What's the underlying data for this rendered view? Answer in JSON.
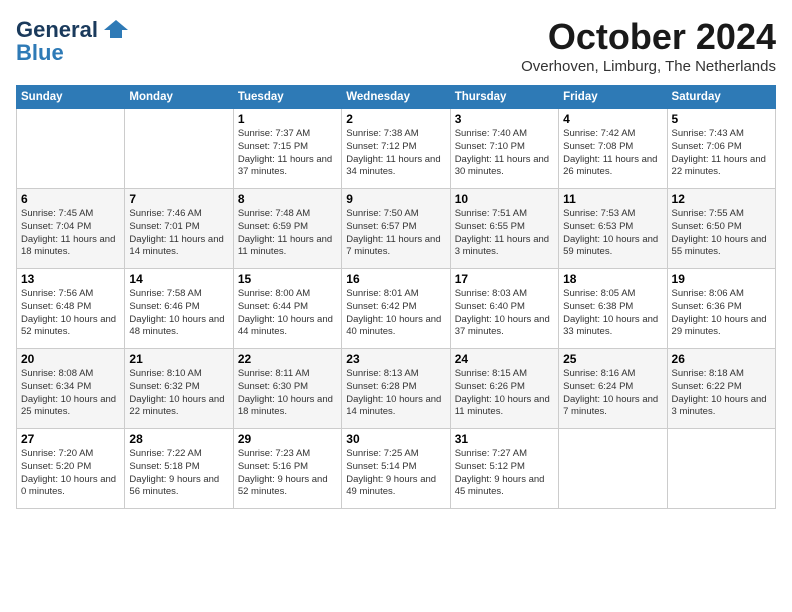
{
  "header": {
    "logo_line1": "General",
    "logo_line2": "Blue",
    "month_title": "October 2024",
    "location": "Overhoven, Limburg, The Netherlands"
  },
  "weekdays": [
    "Sunday",
    "Monday",
    "Tuesday",
    "Wednesday",
    "Thursday",
    "Friday",
    "Saturday"
  ],
  "weeks": [
    [
      {
        "day": "",
        "info": ""
      },
      {
        "day": "",
        "info": ""
      },
      {
        "day": "1",
        "info": "Sunrise: 7:37 AM\nSunset: 7:15 PM\nDaylight: 11 hours and 37 minutes."
      },
      {
        "day": "2",
        "info": "Sunrise: 7:38 AM\nSunset: 7:12 PM\nDaylight: 11 hours and 34 minutes."
      },
      {
        "day": "3",
        "info": "Sunrise: 7:40 AM\nSunset: 7:10 PM\nDaylight: 11 hours and 30 minutes."
      },
      {
        "day": "4",
        "info": "Sunrise: 7:42 AM\nSunset: 7:08 PM\nDaylight: 11 hours and 26 minutes."
      },
      {
        "day": "5",
        "info": "Sunrise: 7:43 AM\nSunset: 7:06 PM\nDaylight: 11 hours and 22 minutes."
      }
    ],
    [
      {
        "day": "6",
        "info": "Sunrise: 7:45 AM\nSunset: 7:04 PM\nDaylight: 11 hours and 18 minutes."
      },
      {
        "day": "7",
        "info": "Sunrise: 7:46 AM\nSunset: 7:01 PM\nDaylight: 11 hours and 14 minutes."
      },
      {
        "day": "8",
        "info": "Sunrise: 7:48 AM\nSunset: 6:59 PM\nDaylight: 11 hours and 11 minutes."
      },
      {
        "day": "9",
        "info": "Sunrise: 7:50 AM\nSunset: 6:57 PM\nDaylight: 11 hours and 7 minutes."
      },
      {
        "day": "10",
        "info": "Sunrise: 7:51 AM\nSunset: 6:55 PM\nDaylight: 11 hours and 3 minutes."
      },
      {
        "day": "11",
        "info": "Sunrise: 7:53 AM\nSunset: 6:53 PM\nDaylight: 10 hours and 59 minutes."
      },
      {
        "day": "12",
        "info": "Sunrise: 7:55 AM\nSunset: 6:50 PM\nDaylight: 10 hours and 55 minutes."
      }
    ],
    [
      {
        "day": "13",
        "info": "Sunrise: 7:56 AM\nSunset: 6:48 PM\nDaylight: 10 hours and 52 minutes."
      },
      {
        "day": "14",
        "info": "Sunrise: 7:58 AM\nSunset: 6:46 PM\nDaylight: 10 hours and 48 minutes."
      },
      {
        "day": "15",
        "info": "Sunrise: 8:00 AM\nSunset: 6:44 PM\nDaylight: 10 hours and 44 minutes."
      },
      {
        "day": "16",
        "info": "Sunrise: 8:01 AM\nSunset: 6:42 PM\nDaylight: 10 hours and 40 minutes."
      },
      {
        "day": "17",
        "info": "Sunrise: 8:03 AM\nSunset: 6:40 PM\nDaylight: 10 hours and 37 minutes."
      },
      {
        "day": "18",
        "info": "Sunrise: 8:05 AM\nSunset: 6:38 PM\nDaylight: 10 hours and 33 minutes."
      },
      {
        "day": "19",
        "info": "Sunrise: 8:06 AM\nSunset: 6:36 PM\nDaylight: 10 hours and 29 minutes."
      }
    ],
    [
      {
        "day": "20",
        "info": "Sunrise: 8:08 AM\nSunset: 6:34 PM\nDaylight: 10 hours and 25 minutes."
      },
      {
        "day": "21",
        "info": "Sunrise: 8:10 AM\nSunset: 6:32 PM\nDaylight: 10 hours and 22 minutes."
      },
      {
        "day": "22",
        "info": "Sunrise: 8:11 AM\nSunset: 6:30 PM\nDaylight: 10 hours and 18 minutes."
      },
      {
        "day": "23",
        "info": "Sunrise: 8:13 AM\nSunset: 6:28 PM\nDaylight: 10 hours and 14 minutes."
      },
      {
        "day": "24",
        "info": "Sunrise: 8:15 AM\nSunset: 6:26 PM\nDaylight: 10 hours and 11 minutes."
      },
      {
        "day": "25",
        "info": "Sunrise: 8:16 AM\nSunset: 6:24 PM\nDaylight: 10 hours and 7 minutes."
      },
      {
        "day": "26",
        "info": "Sunrise: 8:18 AM\nSunset: 6:22 PM\nDaylight: 10 hours and 3 minutes."
      }
    ],
    [
      {
        "day": "27",
        "info": "Sunrise: 7:20 AM\nSunset: 5:20 PM\nDaylight: 10 hours and 0 minutes."
      },
      {
        "day": "28",
        "info": "Sunrise: 7:22 AM\nSunset: 5:18 PM\nDaylight: 9 hours and 56 minutes."
      },
      {
        "day": "29",
        "info": "Sunrise: 7:23 AM\nSunset: 5:16 PM\nDaylight: 9 hours and 52 minutes."
      },
      {
        "day": "30",
        "info": "Sunrise: 7:25 AM\nSunset: 5:14 PM\nDaylight: 9 hours and 49 minutes."
      },
      {
        "day": "31",
        "info": "Sunrise: 7:27 AM\nSunset: 5:12 PM\nDaylight: 9 hours and 45 minutes."
      },
      {
        "day": "",
        "info": ""
      },
      {
        "day": "",
        "info": ""
      }
    ]
  ]
}
